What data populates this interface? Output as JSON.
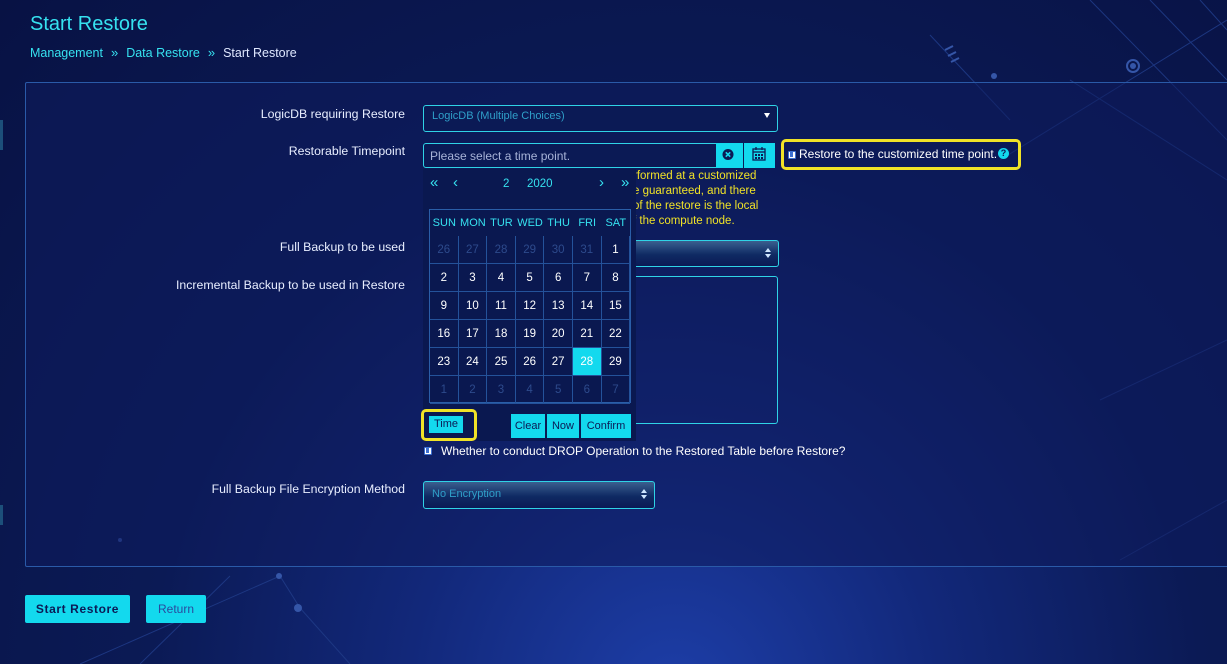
{
  "header": {
    "title": "Start Restore",
    "breadcrumb": [
      "Management",
      "Data Restore",
      "Start Restore"
    ]
  },
  "form": {
    "logicdb": {
      "label": "LogicDB requiring Restore",
      "placeholder": "LogicDB (Multiple Choices)"
    },
    "timepoint": {
      "label": "Restorable Timepoint",
      "placeholder": "Please select a time point.",
      "clear_icon": "close-circle-icon",
      "calendar_icon": "calendar-icon"
    },
    "custom_time": {
      "label": "Restore to the customized time point.",
      "checked": true,
      "help_icon": "?"
    },
    "note_lines": [
      "rformed at a customized",
      "e guaranteed, and there",
      "of the restore is the local",
      "f the compute node."
    ],
    "full_backup": {
      "label": "Full Backup to be used"
    },
    "incremental_backup": {
      "label": "Incremental Backup to be used in Restore"
    },
    "drop_option": {
      "label": "Whether to conduct DROP Operation to the Restored Table before Restore?",
      "checked": true
    },
    "encryption": {
      "label": "Full Backup File Encryption Method",
      "value": "No Encryption"
    }
  },
  "datepicker": {
    "nav": {
      "prev_year": "«",
      "prev_month": "‹",
      "next_month": "›",
      "next_year": "»"
    },
    "month": "2",
    "year": "2020",
    "weekdays": [
      "SUN",
      "MON",
      "TUR",
      "WED",
      "THU",
      "FRI",
      "SAT"
    ],
    "weeks": [
      [
        "26",
        "27",
        "28",
        "29",
        "30",
        "31",
        "1"
      ],
      [
        "2",
        "3",
        "4",
        "5",
        "6",
        "7",
        "8"
      ],
      [
        "9",
        "10",
        "11",
        "12",
        "13",
        "14",
        "15"
      ],
      [
        "16",
        "17",
        "18",
        "19",
        "20",
        "21",
        "22"
      ],
      [
        "23",
        "24",
        "25",
        "26",
        "27",
        "28",
        "29"
      ],
      [
        "1",
        "2",
        "3",
        "4",
        "5",
        "6",
        "7"
      ]
    ],
    "selected_day": "28",
    "buttons": {
      "time": "Time",
      "clear": "Clear",
      "now": "Now",
      "confirm": "Confirm"
    }
  },
  "actions": {
    "start_restore": "Start Restore",
    "return": "Return"
  },
  "colors": {
    "accent": "#13d9ee",
    "highlight": "#f0e227",
    "background": "#0b1a55"
  }
}
